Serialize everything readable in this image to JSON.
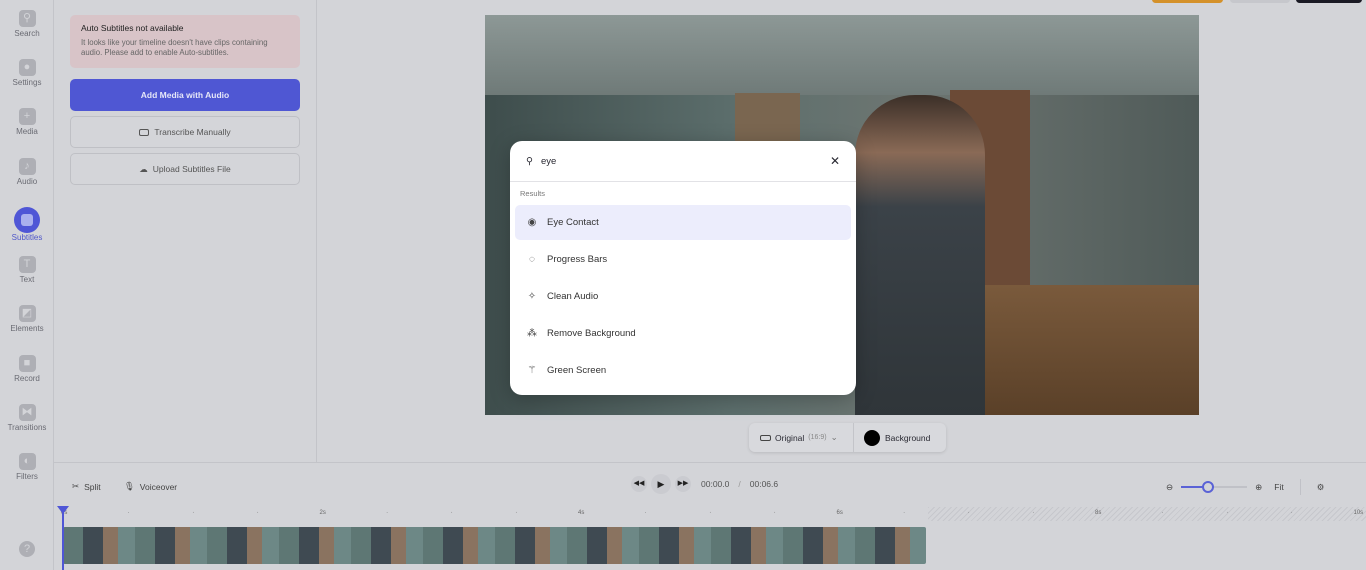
{
  "sidebar": {
    "items": [
      {
        "label": "Search",
        "icon": "search-icon"
      },
      {
        "label": "Settings",
        "icon": "gear-icon"
      },
      {
        "label": "Media",
        "icon": "plus-icon"
      },
      {
        "label": "Audio",
        "icon": "music-note-icon"
      },
      {
        "label": "Subtitles",
        "icon": "subtitles-icon",
        "active": true
      },
      {
        "label": "Text",
        "icon": "text-icon"
      },
      {
        "label": "Elements",
        "icon": "elements-icon"
      },
      {
        "label": "Record",
        "icon": "camera-icon"
      },
      {
        "label": "Transitions",
        "icon": "transitions-icon"
      },
      {
        "label": "Filters",
        "icon": "filters-icon"
      }
    ],
    "help": "?"
  },
  "panel": {
    "alert_title": "Auto Subtitles not available",
    "alert_text": "It looks like your timeline doesn't have clips containing audio. Please add to enable Auto-subtitles.",
    "add_media": "Add Media with Audio",
    "transcribe": "Transcribe Manually",
    "upload": "Upload Subtitles File"
  },
  "preview": {
    "ratio_label": "Original",
    "ratio_value": "(16:9)",
    "background_label": "Background",
    "background_color": "#000000"
  },
  "search": {
    "query": "eye",
    "results_label": "Results",
    "results": [
      {
        "label": "Eye Contact",
        "icon": "eye-icon",
        "selected": true
      },
      {
        "label": "Progress Bars",
        "icon": "progress-circle-icon"
      },
      {
        "label": "Clean Audio",
        "icon": "sparkle-icon"
      },
      {
        "label": "Remove Background",
        "icon": "remove-background-icon"
      },
      {
        "label": "Green Screen",
        "icon": "magic-wand-icon"
      }
    ]
  },
  "timeline": {
    "split": "Split",
    "voiceover": "Voiceover",
    "current_time": "00:00.0",
    "separator": "/",
    "total_time": "00:06.6",
    "fit": "Fit",
    "zoom_level": 0.4,
    "ruler": [
      "0s",
      "2s",
      "4s",
      "6s",
      "8s",
      "10s"
    ]
  },
  "colors": {
    "accent": "#4f56d6",
    "top_orange": "#d4912a",
    "top_dark": "#1a1a24"
  }
}
